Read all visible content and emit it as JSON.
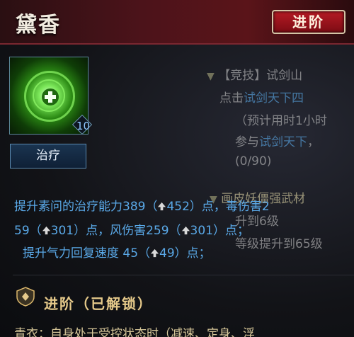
{
  "header": {
    "title": "黛香",
    "advance_label": "进阶"
  },
  "skill": {
    "icon": "healing-cross-icon",
    "level": "10",
    "button_label": "治疗"
  },
  "quest_panel": {
    "line1": "【竞技】试剑山",
    "line2_prefix": "点击",
    "line2_link": "试剑天下四",
    "line3": "（预计用时1小时",
    "line4_prefix": "参与",
    "line4_link": "试剑天下",
    "line4_suffix": "，",
    "progress": "(0/90)",
    "line6": "画皮妖僵强武材",
    "line7": "升到6级",
    "line8": "等级提升到65级"
  },
  "description": {
    "row1_a": "提升素问的治疗能力389（",
    "row1_b": "452）点，毒伤害2",
    "row2_a": "59（",
    "row2_b": "301）点，风伤害259（",
    "row2_c": "301）点；",
    "row3_a": "提升气力回复速度 45（",
    "row3_b": "49）点；"
  },
  "advance_section": {
    "title": "进阶（已解锁）",
    "cut_text": "青衣：自身处于受控状态时（减速、定身、浮"
  },
  "colors": {
    "header_red": "#5a1419",
    "accent_gold": "#e5c98a",
    "text_blue": "#5aa9e8"
  }
}
